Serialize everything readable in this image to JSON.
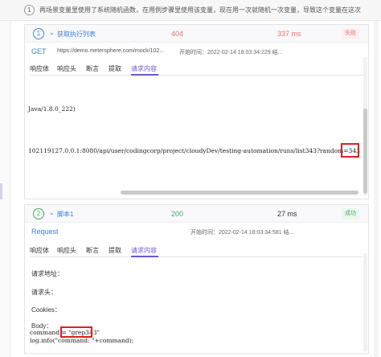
{
  "banner": {
    "number": "1",
    "note": "再场景变量里使用了系统随机函数，在用例步骤里使用该变量，现在用一次就随机一次变量，导致这个变量在这次"
  },
  "step1": {
    "index": "1",
    "name": "获取执行列表",
    "status_code": "404",
    "duration": "337 ms",
    "result": "失败",
    "method": "GET",
    "url": "https://demo.metersphere.com/mock/102...",
    "start_time": "开始时间：2022-02-14 18:03:34:229 结...",
    "tabs": [
      "响应体",
      "响应头",
      "断言",
      "提取",
      "请求内容"
    ],
    "active_tab": "请求内容",
    "line1": "Java/1.8.0_222)",
    "line2": "102119127.0.0.1:8080/api/user/codingcorp/project/cloudyDev/testing-automation/runs/list343?random=343"
  },
  "step2": {
    "index": "2",
    "name": "脚本1",
    "status_code": "200",
    "duration": "27 ms",
    "result": "成功",
    "method": "Request",
    "start_time": "开始时间：2022-02-14 18:03:34:581 结...",
    "tabs": [
      "响应体",
      "响应头",
      "断言",
      "提取",
      "请求内容"
    ],
    "active_tab": "请求内容",
    "labels": {
      "address": "请求地址：",
      "header": "请求头：",
      "cookies": "Cookies：",
      "body": "Body："
    },
    "code1": "command = \"grep343\"",
    "code2": "log.info(\"command: \"+command);"
  },
  "colors": {
    "accent": "#6f55d0",
    "link": "#3b7fd9",
    "fail": "#f56c6c",
    "success": "#41a85f",
    "highlight_box": "#e02020"
  }
}
